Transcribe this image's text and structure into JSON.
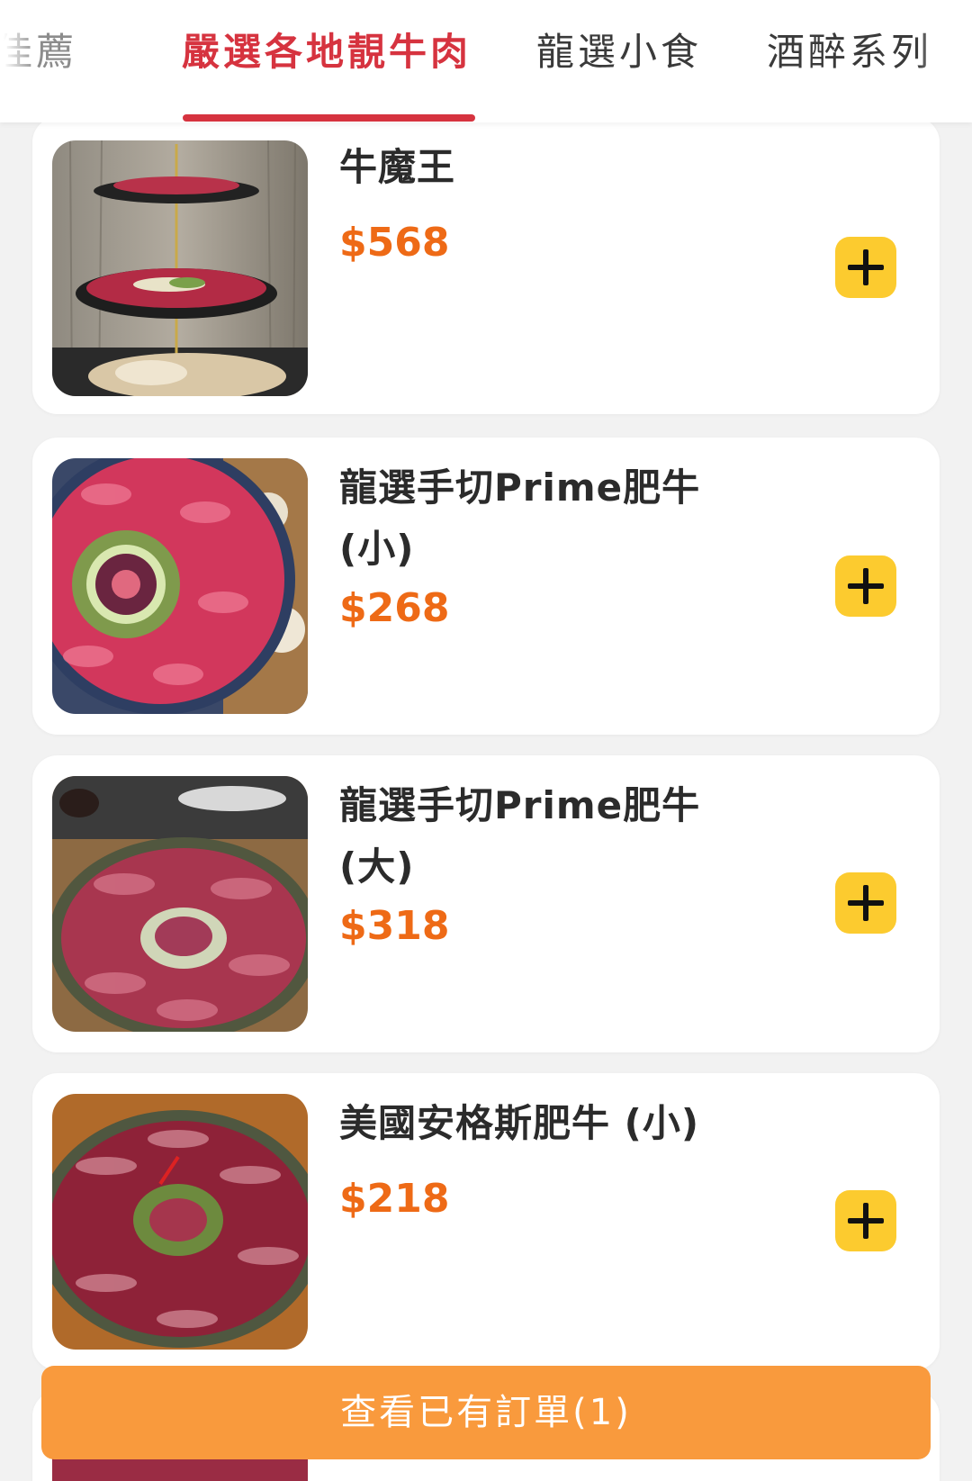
{
  "tabs": [
    {
      "label": "佳薦",
      "state": "partial"
    },
    {
      "label": "嚴選各地靚牛肉",
      "state": "active"
    },
    {
      "label": "龍選小食",
      "state": "normal"
    },
    {
      "label": "酒醉系列",
      "state": "partial"
    }
  ],
  "items": [
    {
      "name": "牛魔王",
      "price": "$568",
      "image": "three-tier-beef-platter-photo"
    },
    {
      "name": "龍選手切Prime肥牛 (小)",
      "price": "$268",
      "image": "round-beef-platter-photo"
    },
    {
      "name": "龍選手切Prime肥牛 (大)",
      "price": "$318",
      "image": "large-beef-platter-photo"
    },
    {
      "name": "美國安格斯肥牛 (小)",
      "price": "$218",
      "image": "angus-beef-platter-photo"
    }
  ],
  "order_bar": {
    "label": "查看已有訂單(1)"
  },
  "colors": {
    "active_tab": "#d6333f",
    "price": "#ee6a16",
    "add_button": "#fccb2f",
    "order_bar": "#f99a3d"
  },
  "icons": {
    "add": "plus-icon"
  }
}
